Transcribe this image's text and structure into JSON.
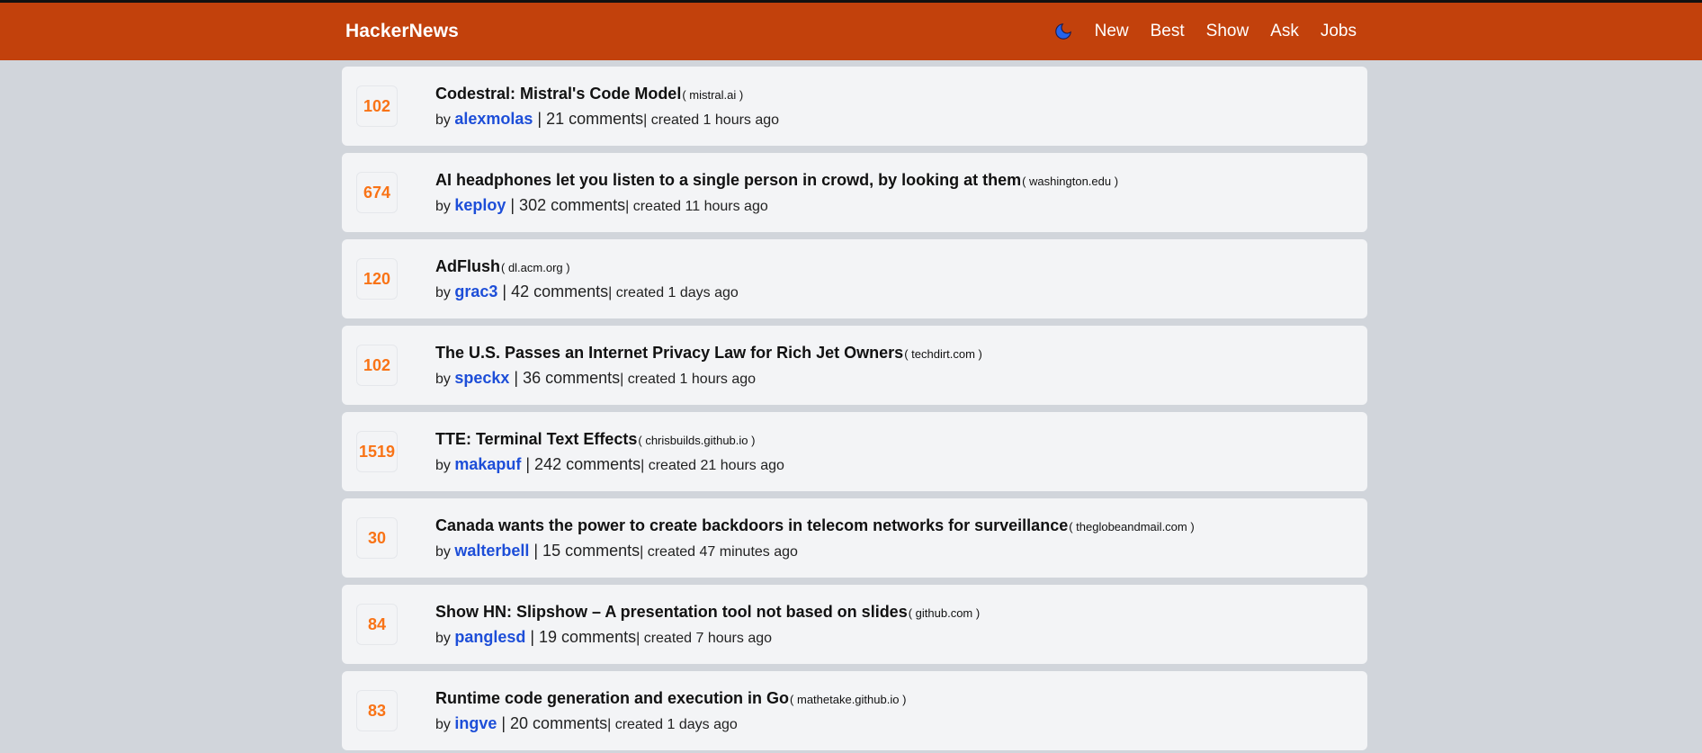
{
  "app": {
    "brand": "HackerNews"
  },
  "nav": {
    "items": [
      "New",
      "Best",
      "Show",
      "Ask",
      "Jobs"
    ]
  },
  "colors": {
    "header": "#c2410c",
    "score": "#f97316",
    "author": "#1d4ed8",
    "background": "#d1d5db",
    "card": "#f3f4f6"
  },
  "icons": {
    "theme": "moon-icon"
  },
  "stories": [
    {
      "score": "102",
      "title": "Codestral: Mistral's Code Model",
      "domain": "( mistral.ai )",
      "by": "by ",
      "author": "alexmolas",
      "comments": " | 21 comments",
      "created": "| created 1 hours ago"
    },
    {
      "score": "674",
      "title": "AI headphones let you listen to a single person in crowd, by looking at them",
      "domain": "( washington.edu )",
      "by": "by ",
      "author": "keploy",
      "comments": " | 302 comments",
      "created": "| created 11 hours ago"
    },
    {
      "score": "120",
      "title": "AdFlush",
      "domain": "( dl.acm.org )",
      "by": "by ",
      "author": "grac3",
      "comments": " | 42 comments",
      "created": "| created 1 days ago"
    },
    {
      "score": "102",
      "title": "The U.S. Passes an Internet Privacy Law for Rich Jet Owners",
      "domain": "( techdirt.com )",
      "by": "by ",
      "author": "speckx",
      "comments": " | 36 comments",
      "created": "| created 1 hours ago"
    },
    {
      "score": "1519",
      "title": "TTE: Terminal Text Effects",
      "domain": "( chrisbuilds.github.io )",
      "by": "by ",
      "author": "makapuf",
      "comments": " | 242 comments",
      "created": "| created 21 hours ago"
    },
    {
      "score": "30",
      "title": "Canada wants the power to create backdoors in telecom networks for surveillance",
      "domain": "( theglobeandmail.com )",
      "by": "by ",
      "author": "walterbell",
      "comments": " | 15 comments",
      "created": "| created 47 minutes ago"
    },
    {
      "score": "84",
      "title": "Show HN: Slipshow – A presentation tool not based on slides",
      "domain": "( github.com )",
      "by": "by ",
      "author": "panglesd",
      "comments": " | 19 comments",
      "created": "| created 7 hours ago"
    },
    {
      "score": "83",
      "title": "Runtime code generation and execution in Go",
      "domain": "( mathetake.github.io )",
      "by": "by ",
      "author": "ingve",
      "comments": " | 20 comments",
      "created": "| created 1 days ago"
    }
  ]
}
